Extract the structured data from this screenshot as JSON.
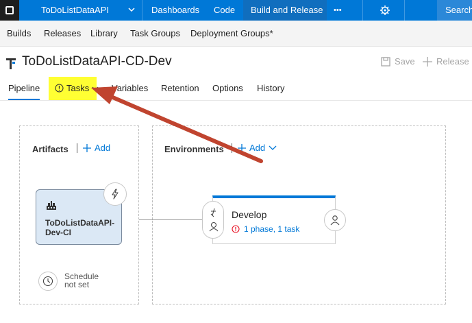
{
  "topbar": {
    "project": "ToDoListDataAPI",
    "nav": [
      "Dashboards",
      "Code",
      "Build and Release"
    ],
    "more": "•••",
    "search": "Search"
  },
  "subnav": [
    "Builds",
    "Releases",
    "Library",
    "Task Groups",
    "Deployment Groups*"
  ],
  "title": "ToDoListDataAPI-CD-Dev",
  "commands": {
    "save": "Save",
    "release": "Release"
  },
  "tabs": [
    "Pipeline",
    "Tasks",
    "Variables",
    "Retention",
    "Options",
    "History"
  ],
  "artifacts": {
    "heading": "Artifacts",
    "add": "Add",
    "card_name": "ToDoListDataAPI-Dev-CI",
    "schedule": "Schedule not set"
  },
  "environments": {
    "heading": "Environments",
    "add": "Add",
    "env_name": "Develop",
    "env_status": "1 phase, 1 task"
  },
  "colors": {
    "accent": "#0078d7",
    "highlight": "#ffff33",
    "annotation_arrow": "#c0442f",
    "warning": "#e81123"
  }
}
